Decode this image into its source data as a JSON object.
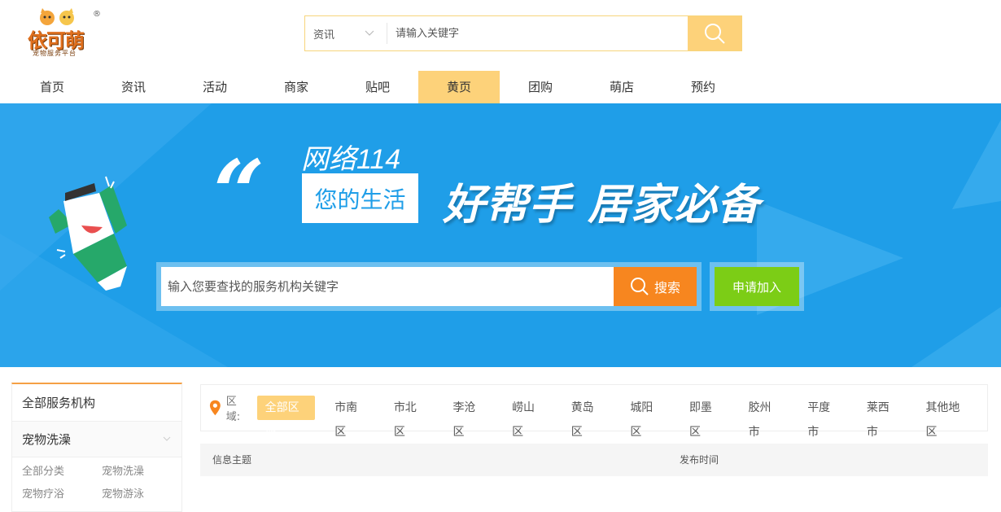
{
  "logo": {
    "text": "依可萌",
    "subtitle": "宠物服务平台",
    "reg": "®"
  },
  "top_search": {
    "category": "资讯",
    "placeholder": "请输入关键字"
  },
  "nav": [
    {
      "label": "首页"
    },
    {
      "label": "资讯"
    },
    {
      "label": "活动"
    },
    {
      "label": "商家"
    },
    {
      "label": "贴吧"
    },
    {
      "label": "黄页",
      "active": true
    },
    {
      "label": "团购"
    },
    {
      "label": "萌店"
    },
    {
      "label": "预约"
    }
  ],
  "banner": {
    "net": "网络114",
    "life": "您的生活",
    "slogan": "好帮手 居家必备",
    "search_placeholder": "输入您要查找的服务机构关键字",
    "search_button": "搜索",
    "join_button": "申请加入"
  },
  "sidebar": {
    "all": "全部服务机构",
    "category": "宠物洗澡",
    "subs": [
      "全部分类",
      "宠物洗澡",
      "宠物疗浴",
      "宠物游泳"
    ]
  },
  "region": {
    "label": "区域:",
    "items": [
      "全部区域",
      "市南区",
      "市北区",
      "李沧区",
      "崂山区",
      "黄岛区",
      "城阳区",
      "即墨区",
      "胶州市",
      "平度市",
      "莱西市",
      "其他地区"
    ],
    "active_index": 0
  },
  "table": {
    "col_topic": "信息主题",
    "col_time": "发布时间"
  },
  "colors": {
    "accent": "#fdd27a",
    "banner": "#1f9ee8",
    "search_btn": "#f7861f",
    "join_btn": "#7ccd16"
  }
}
